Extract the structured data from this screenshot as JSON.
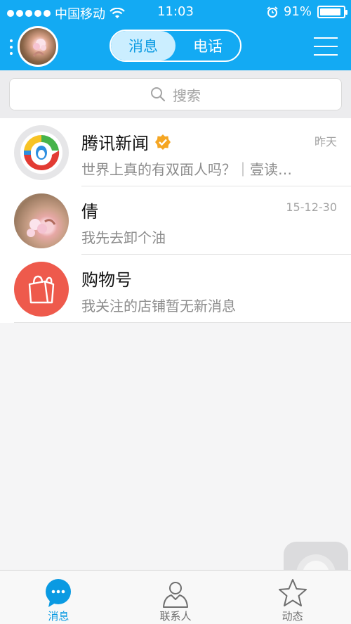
{
  "status": {
    "carrier": "中国移动",
    "time": "11:03",
    "battery": "91%",
    "battery_level": 0.91
  },
  "header": {
    "tabs": [
      {
        "label": "消息",
        "active": true
      },
      {
        "label": "电话",
        "active": false
      }
    ]
  },
  "search": {
    "placeholder": "搜索"
  },
  "conversations": [
    {
      "name": "腾讯新闻",
      "verified": true,
      "preview": "世界上真的有双面人吗？｜壹读…",
      "time": "昨天"
    },
    {
      "name": "倩",
      "verified": false,
      "preview": "我先去卸个油",
      "time": "15-12-30"
    },
    {
      "name": "购物号",
      "verified": false,
      "preview": "我关注的店铺暂无新消息",
      "time": ""
    }
  ],
  "tabbar": {
    "items": [
      {
        "label": "消息",
        "icon": "chat-bubble-icon",
        "active": true
      },
      {
        "label": "联系人",
        "icon": "person-icon",
        "active": false
      },
      {
        "label": "动态",
        "icon": "star-icon",
        "active": false
      }
    ]
  },
  "colors": {
    "header": "#13aaf3",
    "accent": "#0a9ae2",
    "shop_badge": "#ee5a4c",
    "verified": "#f5a623"
  }
}
